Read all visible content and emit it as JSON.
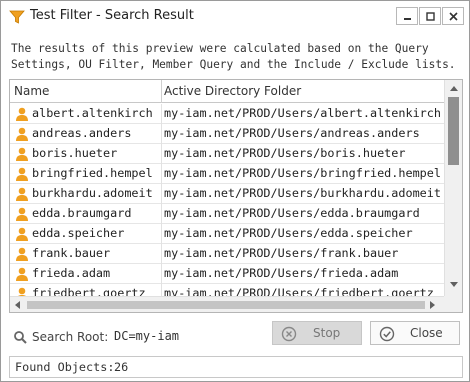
{
  "window": {
    "title": "Test Filter - Search Result"
  },
  "description": {
    "line1": "The results of this preview were calculated based on the Query",
    "line2": "Settings, OU Filter, Member Query and the Include / Exclude lists."
  },
  "table": {
    "columns": [
      "Name",
      "Active Directory Folder"
    ],
    "rows": [
      {
        "name": "albert.altenkirch",
        "folder": "my-iam.net/PROD/Users/albert.altenkirch"
      },
      {
        "name": "andreas.anders",
        "folder": "my-iam.net/PROD/Users/andreas.anders"
      },
      {
        "name": "boris.hueter",
        "folder": "my-iam.net/PROD/Users/boris.hueter"
      },
      {
        "name": "bringfried.hempel",
        "folder": "my-iam.net/PROD/Users/bringfried.hempel"
      },
      {
        "name": "burkhardu.adomeit",
        "folder": "my-iam.net/PROD/Users/burkhardu.adomeit"
      },
      {
        "name": "edda.braumgard",
        "folder": "my-iam.net/PROD/Users/edda.braumgard"
      },
      {
        "name": "edda.speicher",
        "folder": "my-iam.net/PROD/Users/edda.speicher"
      },
      {
        "name": "frank.bauer",
        "folder": "my-iam.net/PROD/Users/frank.bauer"
      },
      {
        "name": "frieda.adam",
        "folder": "my-iam.net/PROD/Users/frieda.adam"
      },
      {
        "name": "friedbert.goertz",
        "folder": "my-iam.net/PROD/Users/friedbert.goertz"
      }
    ]
  },
  "search_root": {
    "label": "Search Root:",
    "value": "DC=my-iam"
  },
  "buttons": {
    "stop": "Stop",
    "close": "Close"
  },
  "found": {
    "label": "Found Objects:",
    "count": "26"
  },
  "icons": {
    "title": "filter-icon",
    "user": "user-icon",
    "search": "magnifier-icon",
    "stop": "stop-circle-icon",
    "close": "check-circle-icon"
  },
  "colors": {
    "user_icon": "#f0a020",
    "scroll_thumb": "#8f8f8f",
    "disabled_button": "#d9d9d9"
  }
}
